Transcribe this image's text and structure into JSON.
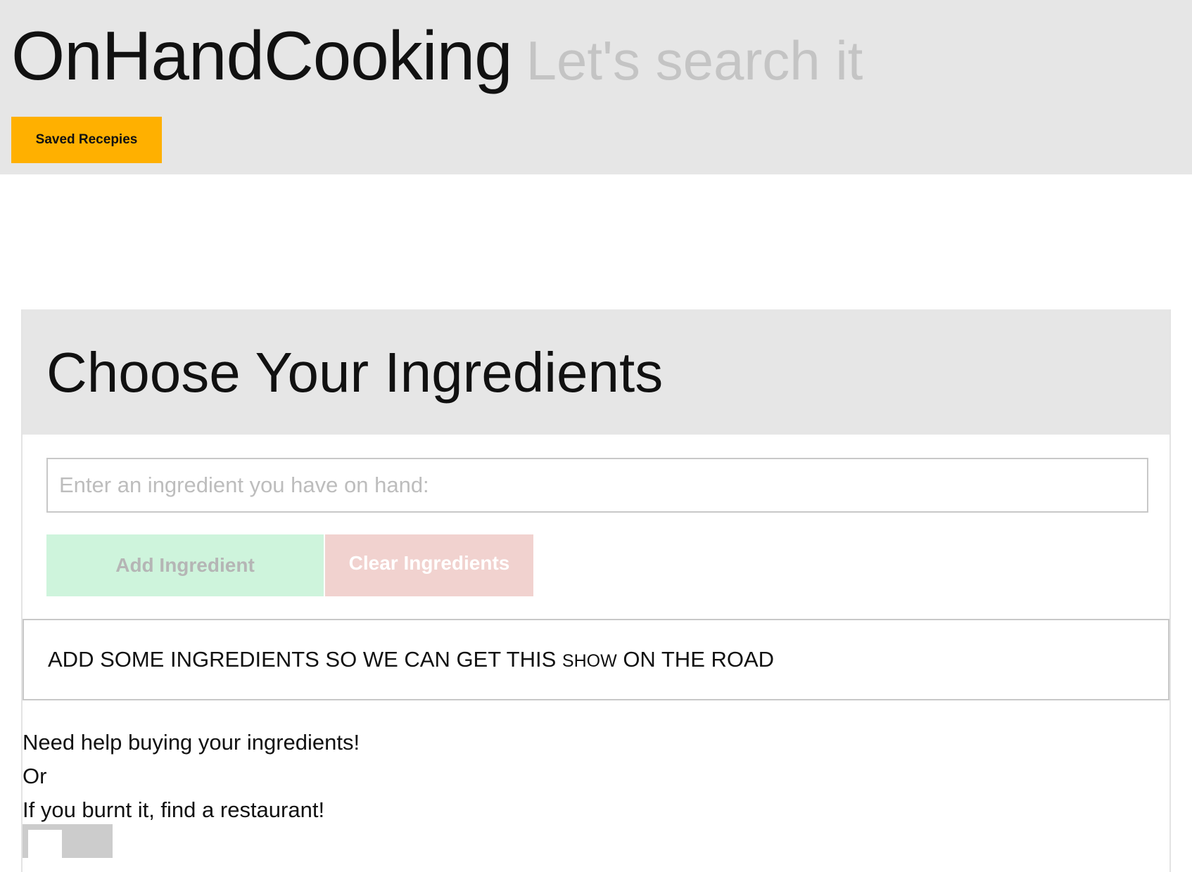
{
  "header": {
    "title": "OnHandCooking",
    "tagline": "Let's search it",
    "saved_button_label": "Saved Recepies"
  },
  "panel": {
    "title": "Choose Your Ingredients",
    "input": {
      "value": "",
      "placeholder": "Enter an ingredient you have on hand:"
    },
    "add_button_label": "Add Ingredient",
    "clear_button_label": "Clear Ingredients",
    "notice": {
      "part1": "ADD SOME INGREDIENTS SO WE CAN GET THIS",
      "part2": "SHOW",
      "part3": "ON THE ROAD"
    },
    "help": {
      "line1": "Need help buying your ingredients!",
      "line2": "Or",
      "line3": "If you burnt it, find a restaurant!"
    }
  },
  "colors": {
    "header_bg": "#e6e6e6",
    "saved_button_bg": "#ffb000",
    "add_button_bg": "#cef4dc",
    "clear_button_bg": "#f1d2cf",
    "tagline_color": "#c4c4c4"
  }
}
